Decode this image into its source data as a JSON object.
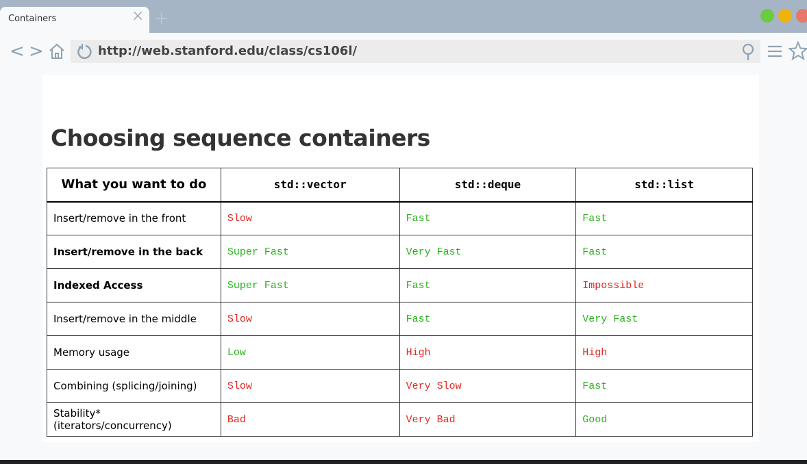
{
  "browser": {
    "tab_title": "Containers",
    "url": "http://web.stanford.edu/class/cs106l/",
    "window_colors": {
      "green": "#6ccb3f",
      "yellow": "#f1b20a",
      "red": "#e8766a"
    }
  },
  "page": {
    "title": "Choosing sequence containers",
    "headers": [
      "What you want to do",
      "std::vector",
      "std::deque",
      "std::list"
    ],
    "rows": [
      {
        "label": "Insert/remove in the front",
        "bold": false,
        "cells": [
          {
            "t": "Slow",
            "s": "bad"
          },
          {
            "t": "Fast",
            "s": "good"
          },
          {
            "t": "Fast",
            "s": "good"
          }
        ]
      },
      {
        "label": "Insert/remove in the back",
        "bold": true,
        "cells": [
          {
            "t": "Super Fast",
            "s": "good"
          },
          {
            "t": "Very Fast",
            "s": "good"
          },
          {
            "t": "Fast",
            "s": "good"
          }
        ]
      },
      {
        "label": "Indexed Access",
        "bold": true,
        "cells": [
          {
            "t": "Super Fast",
            "s": "good"
          },
          {
            "t": "Fast",
            "s": "good"
          },
          {
            "t": "Impossible",
            "s": "bad"
          }
        ]
      },
      {
        "label": "Insert/remove in the middle",
        "bold": false,
        "cells": [
          {
            "t": "Slow",
            "s": "bad"
          },
          {
            "t": "Fast",
            "s": "good"
          },
          {
            "t": "Very Fast",
            "s": "good"
          }
        ]
      },
      {
        "label": "Memory usage",
        "bold": false,
        "cells": [
          {
            "t": "Low",
            "s": "good"
          },
          {
            "t": "High",
            "s": "bad"
          },
          {
            "t": "High",
            "s": "bad"
          }
        ]
      },
      {
        "label": "Combining (splicing/joining)",
        "bold": false,
        "cells": [
          {
            "t": "Slow",
            "s": "bad"
          },
          {
            "t": "Very Slow",
            "s": "bad"
          },
          {
            "t": "Fast",
            "s": "good"
          }
        ]
      },
      {
        "label": "Stability* (iterators/concurrency)",
        "bold": false,
        "cells": [
          {
            "t": "Bad",
            "s": "bad"
          },
          {
            "t": "Very Bad",
            "s": "bad"
          },
          {
            "t": "Good",
            "s": "good"
          }
        ]
      }
    ]
  }
}
